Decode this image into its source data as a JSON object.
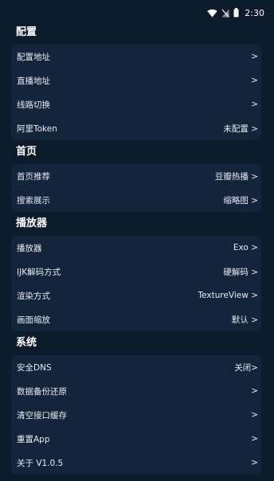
{
  "status_bar": {
    "time": "2:30",
    "icons": [
      "wifi-icon",
      "signal-off-icon",
      "battery-icon"
    ]
  },
  "sections": [
    {
      "title": "配置",
      "items": [
        {
          "label": "配置地址",
          "value": ">"
        },
        {
          "label": "直播地址",
          "value": ">"
        },
        {
          "label": "线路切换",
          "value": ">"
        },
        {
          "label": "阿里Token",
          "value": "未配置 >"
        }
      ]
    },
    {
      "title": "首页",
      "items": [
        {
          "label": "首页推荐",
          "value": "豆瓣热播 >"
        },
        {
          "label": "搜索展示",
          "value": "缩略图 >"
        }
      ]
    },
    {
      "title": "播放器",
      "items": [
        {
          "label": "播放器",
          "value": "Exo >"
        },
        {
          "label": "IJK解码方式",
          "value": "硬解码 >"
        },
        {
          "label": "渲染方式",
          "value": "TextureView >"
        },
        {
          "label": "画面缩放",
          "value": "默认 >"
        }
      ]
    },
    {
      "title": "系统",
      "items": [
        {
          "label": "安全DNS",
          "value": "关闭>"
        },
        {
          "label": "数据备份还原",
          "value": ">"
        },
        {
          "label": "清空接口缓存",
          "value": ">"
        },
        {
          "label": "重置App",
          "value": ">"
        },
        {
          "label": "关于  V1.0.5",
          "value": ">"
        }
      ]
    }
  ]
}
